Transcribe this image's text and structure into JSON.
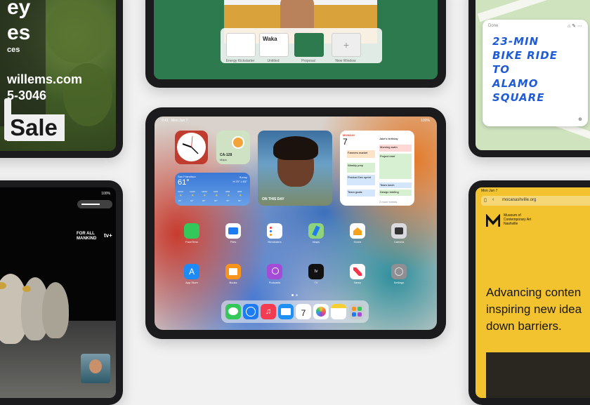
{
  "realty": {
    "line1": "ey",
    "line2": "es",
    "line3": "ces",
    "email": "willems.com",
    "phone": "5-3046",
    "sale": "Sale"
  },
  "stage": {
    "thumb_title": "Waka",
    "thumb_labels": [
      "Energy Kickstarter",
      "Untitled",
      "Proposal",
      "New Window"
    ]
  },
  "note": {
    "done": "Done",
    "lines": [
      "23-MIN",
      "BIKE RIDE",
      "TO",
      "ALAMO",
      "SQUARE"
    ]
  },
  "ipad": {
    "status_time": "9:41",
    "status_date": "Mon Jun 7",
    "battery": "100%",
    "maps_label": "CA-128",
    "maps_sub": "Maps",
    "weather": {
      "city": "San Francisco",
      "temp": "61°",
      "cond": "Sunny",
      "range": "H:70° L:53°",
      "hours": [
        "10AM",
        "11AM",
        "12PM",
        "1PM",
        "2PM",
        "3PM"
      ],
      "temps": [
        "61°",
        "64°",
        "66°",
        "68°",
        "70°",
        "69°"
      ]
    },
    "photo_caption": "ON THIS DAY",
    "calendar": {
      "month": "MONDAY",
      "day": "7",
      "events_left": [
        "Farmers market",
        "Weekly prep",
        "Product Dev sprint",
        "Team goals"
      ],
      "events_right": [
        "Jake's birthday",
        "Morning swim",
        "Project brief",
        "Team lunch",
        "Design briefing"
      ],
      "footer": "2 more events"
    },
    "apps_row1": [
      "FaceTime",
      "Files",
      "Reminders",
      "Maps",
      "Home",
      "Camera"
    ],
    "apps_row2": [
      "App Store",
      "Books",
      "Podcasts",
      "TV",
      "News",
      "Settings"
    ],
    "dock": [
      "Messages",
      "Safari",
      "Music",
      "Mail",
      "Calendar",
      "Photos",
      "Notes",
      "App Library"
    ],
    "cal_icon_day": "7"
  },
  "tv": {
    "show": "FOR ALL MANKIND",
    "brand": "tv+",
    "battery": "100%"
  },
  "museum": {
    "status": "Mon Jun 7",
    "url": "mocanashville.org",
    "logo_text": "Museum of Contemporary Art Nashville",
    "lines": [
      "Advancing conten",
      "inspiring new idea",
      "down barriers."
    ]
  },
  "colors": {
    "museum_yellow": "#f2c22f",
    "notes_ink": "#1f5bd6",
    "stage_green": "#2e7a4f"
  }
}
